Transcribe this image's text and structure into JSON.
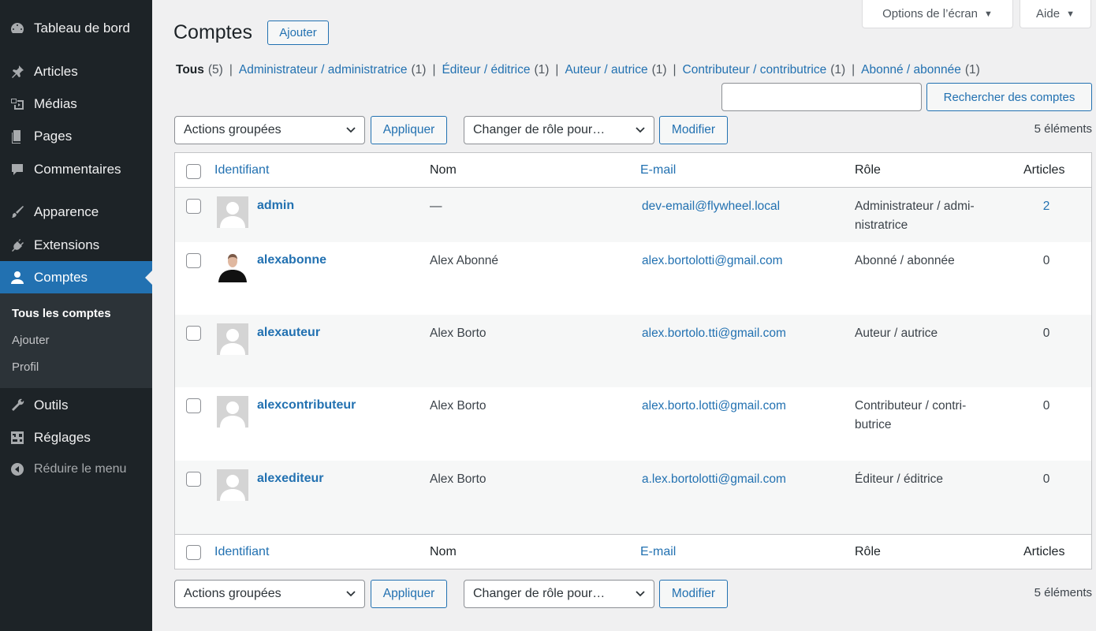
{
  "sidebar": {
    "items": [
      {
        "label": "Tableau de bord",
        "icon": "dashboard-icon"
      },
      {
        "label": "Articles",
        "icon": "pin-icon"
      },
      {
        "label": "Médias",
        "icon": "media-icon"
      },
      {
        "label": "Pages",
        "icon": "pages-icon"
      },
      {
        "label": "Commentaires",
        "icon": "comment-icon"
      },
      {
        "label": "Apparence",
        "icon": "brush-icon"
      },
      {
        "label": "Extensions",
        "icon": "plugin-icon"
      },
      {
        "label": "Comptes",
        "icon": "user-icon"
      },
      {
        "label": "Outils",
        "icon": "wrench-icon"
      },
      {
        "label": "Réglages",
        "icon": "settings-icon"
      },
      {
        "label": "Réduire le menu",
        "icon": "collapse-icon"
      }
    ],
    "submenu": [
      "Tous les comptes",
      "Ajouter",
      "Profil"
    ]
  },
  "screen_options": "Options de l’écran",
  "help": "Aide",
  "page": {
    "title": "Comptes",
    "add_new": "Ajouter"
  },
  "filters": [
    {
      "label": "Tous",
      "count": "(5)"
    },
    {
      "label": "Administrateur / administratrice",
      "count": "(1)"
    },
    {
      "label": "Éditeur / éditrice",
      "count": "(1)"
    },
    {
      "label": "Auteur / autrice",
      "count": "(1)"
    },
    {
      "label": "Contributeur / contributrice",
      "count": "(1)"
    },
    {
      "label": "Abonné / abonnée",
      "count": "(1)"
    }
  ],
  "search": {
    "value": "",
    "button": "Rechercher des comptes"
  },
  "tablenav": {
    "bulk_actions": "Actions groupées",
    "apply": "Appliquer",
    "change_role": "Changer de rôle pour…",
    "modify": "Modifier",
    "count": "5 éléments"
  },
  "table": {
    "headers": {
      "username": "Identifiant",
      "name": "Nom",
      "email": "E-mail",
      "role": "Rôle",
      "posts": "Articles"
    },
    "rows": [
      {
        "username": "admin",
        "name": "—",
        "email": "dev-email@flywheel.local",
        "role": "Administrateur / admi-nistratrice",
        "posts": "2"
      },
      {
        "username": "alexabonne",
        "name": "Alex Abonné",
        "email": "alex.bortolotti@gmail.com",
        "role": "Abonné / abonnée",
        "posts": "0"
      },
      {
        "username": "alexauteur",
        "name": "Alex Borto",
        "email": "alex.bortolo.tti@gmail.com",
        "role": "Auteur / autrice",
        "posts": "0"
      },
      {
        "username": "alexcontributeur",
        "name": "Alex Borto",
        "email": "alex.borto.lotti@gmail.com",
        "role": "Contributeur / contri-butrice",
        "posts": "0"
      },
      {
        "username": "alexediteur",
        "name": "Alex Borto",
        "email": "a.lex.bortolotti@gmail.com",
        "role": "Éditeur / éditrice",
        "posts": "0"
      }
    ]
  },
  "colors": {
    "sidebar_bg": "#1d2327",
    "accent": "#2271b1",
    "page_bg": "#f0f0f1"
  }
}
